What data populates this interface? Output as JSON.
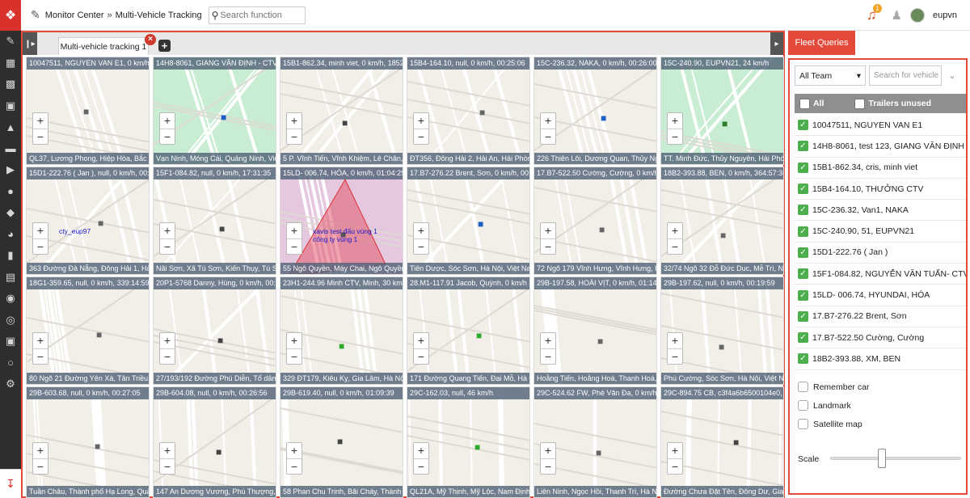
{
  "header": {
    "breadcrumb": [
      "Monitor Center",
      "»",
      "Multi-Vehicle Tracking"
    ],
    "search_placeholder": "Search function",
    "notification_count": "1",
    "username": "eupvn"
  },
  "tabs": [
    {
      "label": "Multi-vehicle tracking 1"
    }
  ],
  "map_cells": [
    {
      "title": "10047511, NGUYEN VAN E1, 0 km/h, Bắc Gi",
      "address": "QL37, Lương Phong, Hiệp Hòa, Bắc Gia",
      "bg": "#f2efe9",
      "vehicle_color": "#666"
    },
    {
      "title": "14H8-8061, GIANG VĂN ĐỊNH - CTV Hỏ",
      "address": "Vạn Ninh, Móng Cái, Quảng Ninh, Việt N",
      "bg": "#c8edd2",
      "vehicle_color": "#1e5fc4"
    },
    {
      "title": "15B1-862.34, minh viet, 0 km/h, 1852:48",
      "address": "5 P. Vĩnh Tiến, Vĩnh Khiệm, Lê Chân, Hả",
      "bg": "#f2efe9",
      "vehicle_color": "#444"
    },
    {
      "title": "15B4-164.10, null, 0 km/h, 00:25:06",
      "address": "ĐT356, Đông Hải 2, Hải An, Hải Phòng,",
      "bg": "#f2efe9",
      "vehicle_color": "#666"
    },
    {
      "title": "15C-236.32, NAKA, 0 km/h, 00:26:00",
      "address": "226 Thiên Lôi, Dương Quan, Thủy Nguy",
      "bg": "#f2efe9",
      "vehicle_color": "#1e5fc4"
    },
    {
      "title": "15C-240.90, EUPVN21, 24 km/h",
      "address": "TT. Minh Đức, Thủy Nguyên, Hải Phòn",
      "bg": "#c8edd2",
      "vehicle_color": "#2a7a2a"
    },
    {
      "title": "15D1-222.76 ( Jan ), null, 0 km/h, 00:42",
      "address": "363 Đường Đà Nẵng, Đông Hải 1, Hải A",
      "bg": "#f2efe9",
      "vehicle_color": "#666",
      "label": "cty_eup97"
    },
    {
      "title": "15F1-084.82, null, 0 km/h, 17:31:35",
      "address": "Nãi Sơn, Xã Tú Sơn, Kiến Thụy, Tú Sơn",
      "bg": "#f2efe9",
      "vehicle_color": "#444"
    },
    {
      "title": "15LD- 006.74, HÓA, 0 km/h, 01:04:29",
      "address": "55 Ngô Quyền, Máy Chai, Ngô Quyền, Hả",
      "bg": "#e5c8e0",
      "vehicle_color": "#555",
      "label": "xavis test đấu vùng 1 công ty vùng 1"
    },
    {
      "title": "17.B7-276.22 Brent, Sơn, 0 km/h, 00:29",
      "address": "Tiên Dược, Sóc Sơn, Hà Nội, Việt Nam",
      "bg": "#f2efe9",
      "vehicle_color": "#1e5fc4"
    },
    {
      "title": "17.B7-522.50 Cường, Cường, 0 km/h, 01",
      "address": "72 Ngõ 179 Vĩnh Hưng, Vĩnh Hưng, Hoà",
      "bg": "#f2efe9",
      "vehicle_color": "#666"
    },
    {
      "title": "18B2-393.88, BEN, 0 km/h, 364:57:38",
      "address": "32/74 Ngõ 32 Đỗ Đức Dục, Mễ Trì, Nam",
      "bg": "#f2efe9",
      "vehicle_color": "#666"
    },
    {
      "title": "18G1-359.65, null, 0 km/h, 339:14:59",
      "address": "80 Ngõ 21 Đường Yên Xá, Tân Triều, Th",
      "bg": "#f2efe9",
      "vehicle_color": "#666"
    },
    {
      "title": "20P1-5768 Danny, Hùng, 0 km/h, 00:19",
      "address": "27/193/192 Đường Phú Diễn, Tổ dân phố",
      "bg": "#f2efe9",
      "vehicle_color": "#444"
    },
    {
      "title": "23H1-244.96 Minh CTV, Minh, 30 km/h",
      "address": "329 ĐT179, Kiêu Kỵ, Gia Lâm, Hà Nội, Vi",
      "bg": "#f2efe9",
      "vehicle_color": "#2eaa2e"
    },
    {
      "title": "28.M1-117.91 Jacob, Quỳnh, 0 km/h",
      "address": "171 Đường Quang Tiến, Đại Mỗ, Hà Đô",
      "bg": "#f2efe9",
      "vehicle_color": "#2eaa2e"
    },
    {
      "title": "29B-197.58, HOÀI VỊT, 0 km/h, 01:14:56",
      "address": "Hoằng Tiến, Hoằng Hoá, Thanh Hoá, Vi",
      "bg": "#f2efe9",
      "vehicle_color": "#666"
    },
    {
      "title": "29B-197.62, null, 0 km/h, 00:19:59",
      "address": "Phú Cường, Sóc Sơn, Hà Nội, Việt Nam",
      "bg": "#f2efe9",
      "vehicle_color": "#666"
    },
    {
      "title": "29B-603.68, null, 0 km/h, 00:27:05",
      "address": "Tuần Châu, Thành phố Hạ Long, Quảng",
      "bg": "#f2efe9",
      "vehicle_color": "#666"
    },
    {
      "title": "29B-604.08, null, 0 km/h, 00:26:56",
      "address": "147 An Dương Vương, Phú Thượng, Tâ",
      "bg": "#f2efe9",
      "vehicle_color": "#444"
    },
    {
      "title": "29B-619.40, null, 0 km/h, 01:09:39",
      "address": "58 Phan Chu Trinh, Bãi Cháy, Thành phố",
      "bg": "#f2efe9",
      "vehicle_color": "#444"
    },
    {
      "title": "29C-162.03, null, 46 km/h",
      "address": "QL21A, Mỹ Thịnh, Mỹ Lộc, Nam Định, Vi",
      "bg": "#f2efe9",
      "vehicle_color": "#2eaa2e"
    },
    {
      "title": "29C-524.62 FW, Phè Văn Đa, 0 km/h, 01",
      "address": "Liên Ninh, Ngọc Hồi, Thanh Trì, Hà Nội,",
      "bg": "#f2efe9",
      "vehicle_color": "#666"
    },
    {
      "title": "29C-894.75 CB, c3f4a6b6500104e0, 0",
      "address": "Đường Chưa Đặt Tên, Đông Dư, Gia Lâ",
      "bg": "#f2efe9",
      "vehicle_color": "#444"
    }
  ],
  "fleet": {
    "title": "Fleet Queries",
    "team_select": "All Team",
    "search_placeholder": "Search for vehicle",
    "all_label": "All",
    "trailers_label": "Trailers unused",
    "vehicles": [
      "10047511, NGUYEN VAN E1",
      "14H8-8061, test 123, GIANG VĂN ĐỊNH -",
      "15B1-862.34, cris, minh viet",
      "15B4-164.10, THƯỞNG CTV",
      "15C-236.32, Van1, NAKA",
      "15C-240.90, 51, EUPVN21",
      "15D1-222.76 ( Jan )",
      "15F1-084.82, NGUYỄN VĂN TUẤN- CTV",
      "15LD- 006.74, HYUNDAI, HÓA",
      "17.B7-276.22 Brent, Sơn",
      "17.B7-522.50 Cường, Cường",
      "18B2-393.88, XM, BEN"
    ],
    "options": [
      "Remember car",
      "Landmark",
      "Satellite map"
    ],
    "scale_label": "Scale",
    "scale_value": 0.39
  },
  "colors": {
    "accent": "#e34a3c",
    "check": "#4cae4c",
    "sidebar": "#2e2e2e"
  }
}
